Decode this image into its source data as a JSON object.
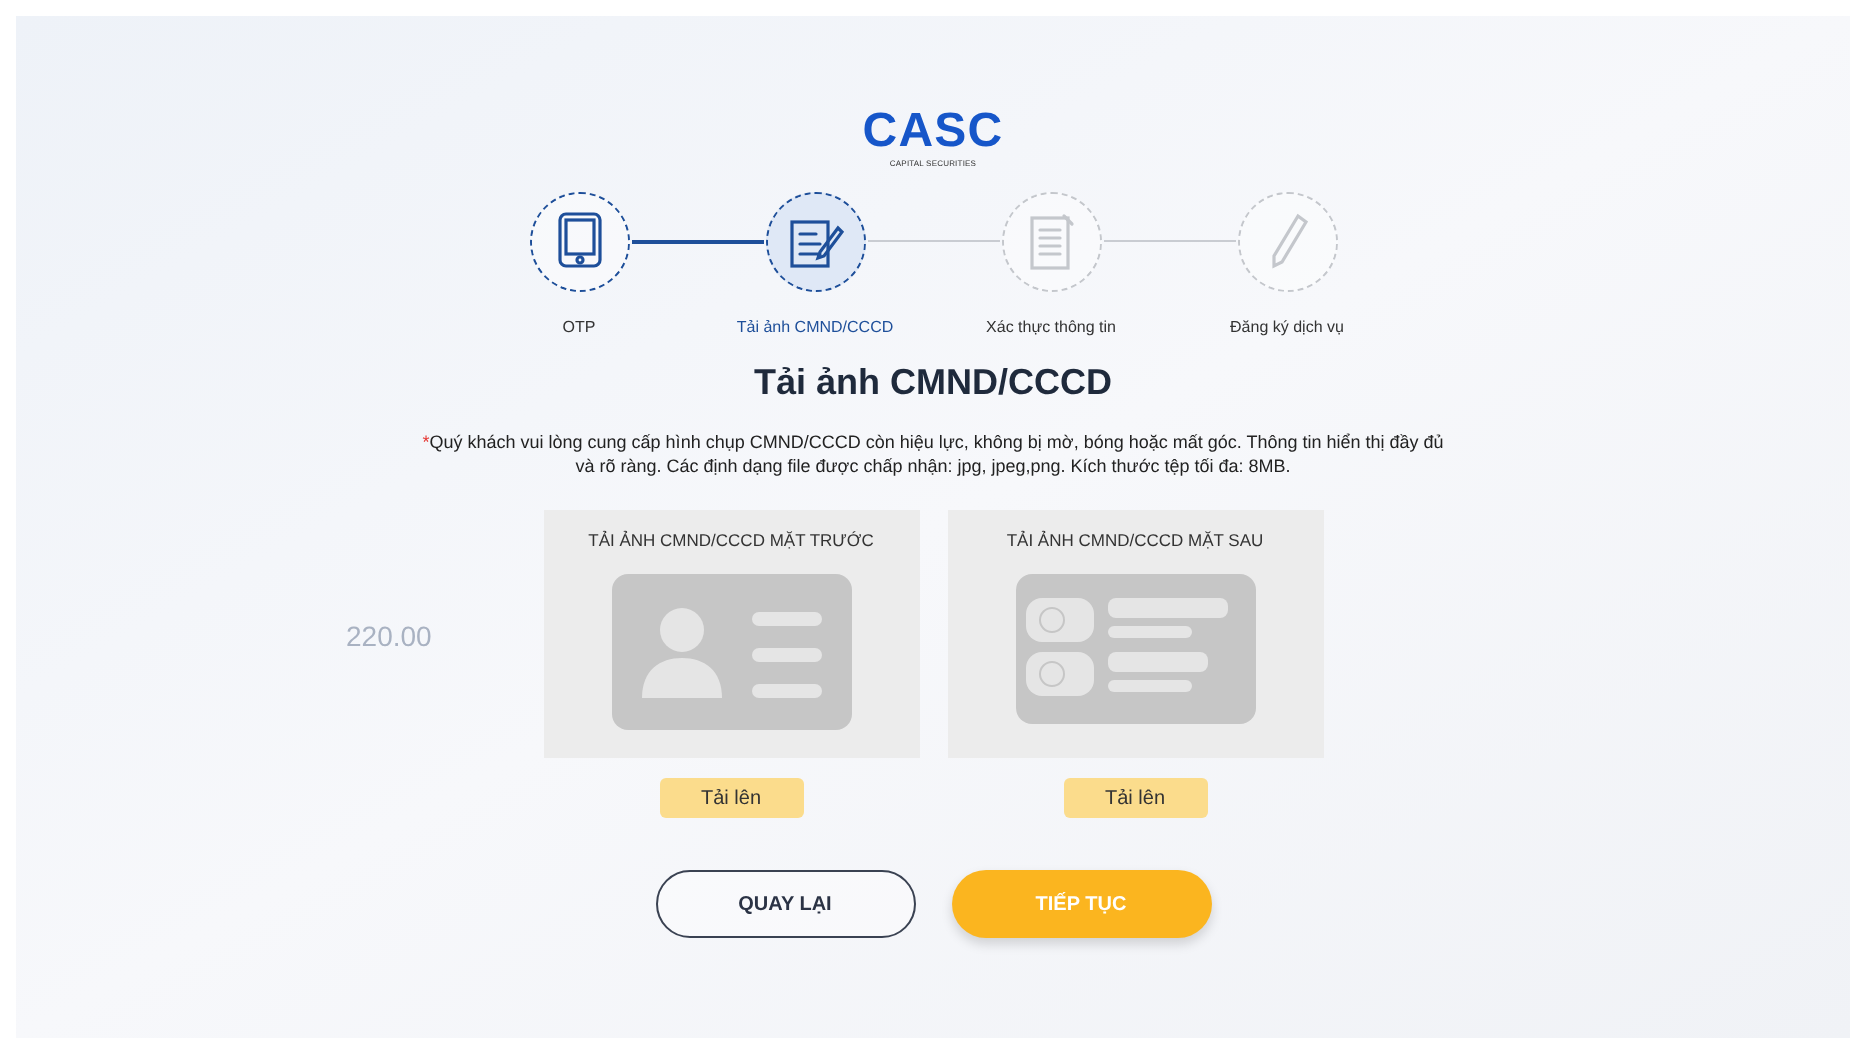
{
  "logo": {
    "name": "CASC",
    "tagline": "CAPITAL SECURITIES"
  },
  "background_label": "220.00",
  "steps": [
    {
      "kind": "phone",
      "label": "OTP",
      "done": true,
      "selected": false
    },
    {
      "kind": "form",
      "label": "Tải ảnh CMND/CCCD",
      "done": false,
      "selected": true
    },
    {
      "kind": "document",
      "label": "Xác thực thông tin",
      "done": false,
      "selected": false
    },
    {
      "kind": "pen",
      "label": "Đăng ký dịch vụ",
      "done": false,
      "selected": false
    }
  ],
  "title": "Tải ảnh CMND/CCCD",
  "note": {
    "mark": "*",
    "text": "Quý khách vui lòng cung cấp hình chụp CMND/CCCD còn hiệu lực, không bị mờ, bóng hoặc mất góc. Thông tin hiển thị đầy đủ và rõ ràng. Các định dạng file được chấp nhận: jpg, jpeg,png. Kích thước tệp tối đa: 8MB."
  },
  "uploads": [
    {
      "kind": "front",
      "title": "TẢI ẢNH CMND/CCCD MẶT TRƯỚC",
      "button": "Tải lên"
    },
    {
      "kind": "back",
      "title": "TẢI ẢNH CMND/CCCD MẶT SAU",
      "button": "Tải lên"
    }
  ],
  "actions": [
    {
      "kind": "secondary",
      "label": "QUAY LẠI"
    },
    {
      "kind": "primary",
      "label": "TIẾP TỤC"
    }
  ]
}
